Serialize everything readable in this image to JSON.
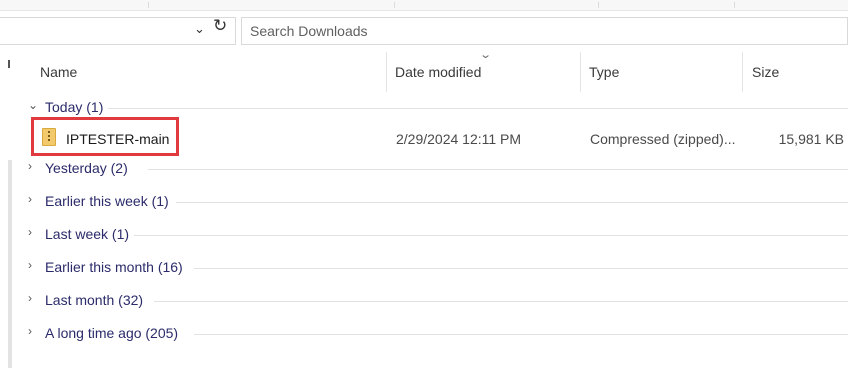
{
  "search": {
    "placeholder": "Search Downloads"
  },
  "icons": {
    "address_dropdown": "chevron-down-icon",
    "refresh": "refresh-icon",
    "sort": "chevron-down-icon",
    "group_expanded": "chevron-down-icon",
    "group_collapsed": "chevron-right-icon",
    "zip_file": "zip-folder-icon"
  },
  "columns": [
    {
      "label": "Name"
    },
    {
      "label": "Date modified"
    },
    {
      "label": "Type"
    },
    {
      "label": "Size"
    }
  ],
  "groups": [
    {
      "label": "Today (1)",
      "expanded": true
    },
    {
      "label": "Yesterday (2)",
      "expanded": false
    },
    {
      "label": "Earlier this week (1)",
      "expanded": false
    },
    {
      "label": "Last week (1)",
      "expanded": false
    },
    {
      "label": "Earlier this month (16)",
      "expanded": false
    },
    {
      "label": "Last month (32)",
      "expanded": false
    },
    {
      "label": "A long time ago (205)",
      "expanded": false
    }
  ],
  "files": [
    {
      "name": "IPTESTER-main",
      "date_modified": "2/29/2024 12:11 PM",
      "type": "Compressed (zipped)...",
      "size": "15,981 KB"
    }
  ],
  "colors": {
    "highlight": "#e0393e",
    "zip_icon": "#f2c96b",
    "group_label": "#2b2b6b"
  }
}
